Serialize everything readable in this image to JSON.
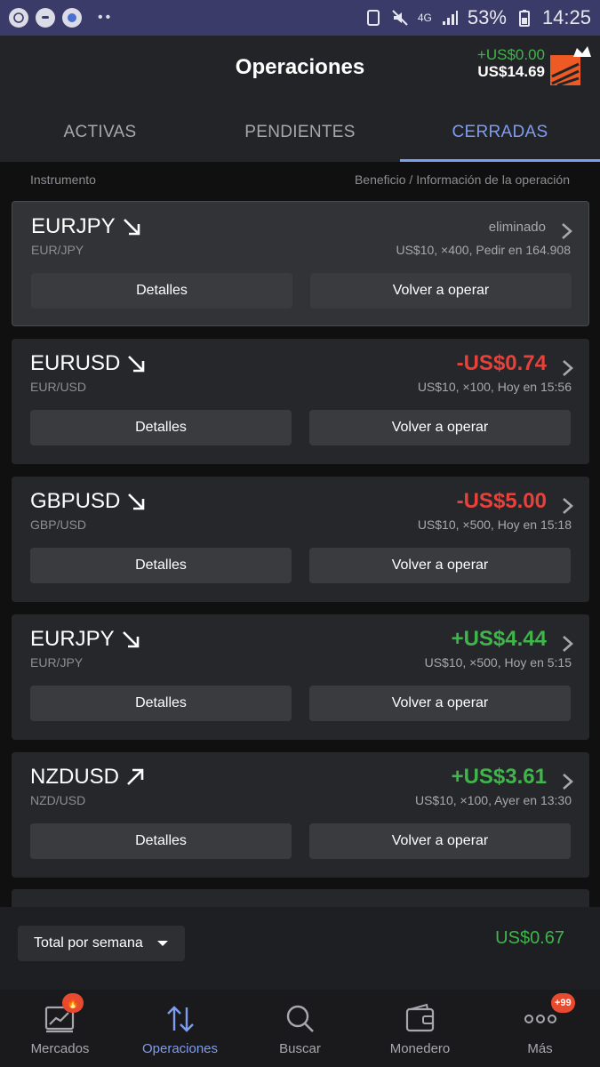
{
  "status_bar": {
    "network": "4G",
    "battery": "53%",
    "time": "14:25"
  },
  "header": {
    "title": "Operaciones",
    "pnl_change": "+US$0.00",
    "balance": "US$14.69"
  },
  "tabs": [
    {
      "label": "ACTIVAS",
      "active": false
    },
    {
      "label": "PENDIENTES",
      "active": false
    },
    {
      "label": "CERRADAS",
      "active": true
    }
  ],
  "columns": {
    "left": "Instrumento",
    "right": "Beneficio / Información de la operación"
  },
  "trades": [
    {
      "symbol": "EURJPY",
      "pair": "EUR/JPY",
      "direction": "down",
      "result": "eliminado",
      "result_kind": "muted",
      "info": "US$10, ×400, Pedir en 164.908"
    },
    {
      "symbol": "EURUSD",
      "pair": "EUR/USD",
      "direction": "down",
      "result": "-US$0.74",
      "result_kind": "neg",
      "info": "US$10, ×100, Hoy en 15:56"
    },
    {
      "symbol": "GBPUSD",
      "pair": "GBP/USD",
      "direction": "down",
      "result": "-US$5.00",
      "result_kind": "neg",
      "info": "US$10, ×500, Hoy en 15:18"
    },
    {
      "symbol": "EURJPY",
      "pair": "EUR/JPY",
      "direction": "down",
      "result": "+US$4.44",
      "result_kind": "pos",
      "info": "US$10, ×500, Hoy en 5:15"
    },
    {
      "symbol": "NZDUSD",
      "pair": "NZD/USD",
      "direction": "up",
      "result": "+US$3.61",
      "result_kind": "pos",
      "info": "US$10, ×100, Ayer en 13:30"
    }
  ],
  "buttons": {
    "details": "Detalles",
    "retrade": "Volver a operar"
  },
  "summary": {
    "period": "Total por semana",
    "total": "US$0.67"
  },
  "nav": [
    {
      "label": "Mercados",
      "icon": "chart-icon",
      "badge": ""
    },
    {
      "label": "Operaciones",
      "icon": "trades-icon",
      "badge": ""
    },
    {
      "label": "Buscar",
      "icon": "search-icon",
      "badge": ""
    },
    {
      "label": "Monedero",
      "icon": "wallet-icon",
      "badge": ""
    },
    {
      "label": "Más",
      "icon": "more-icon",
      "badge": "+99"
    }
  ],
  "colors": {
    "accent": "#7e9cf1",
    "positive": "#3fb54a",
    "negative": "#e8413a"
  }
}
